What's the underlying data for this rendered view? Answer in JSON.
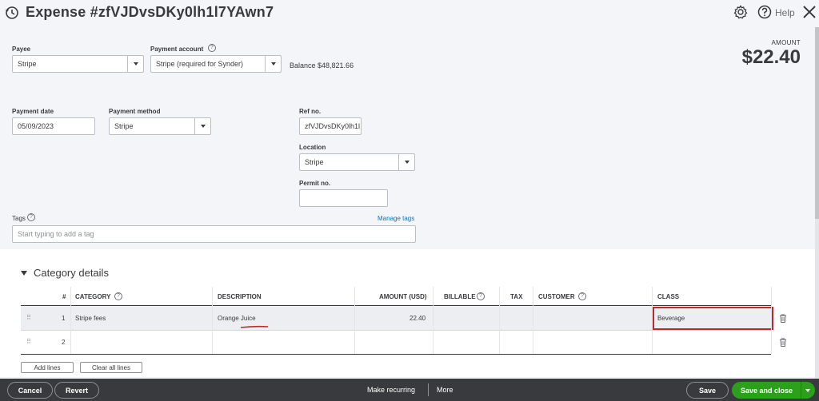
{
  "header": {
    "title": "Expense #zfVJDvsDKy0lh1l7YAwn7",
    "help_label": "Help"
  },
  "form": {
    "payee": {
      "label": "Payee",
      "value": "Stripe"
    },
    "payment_account": {
      "label": "Payment account",
      "value": "Stripe (required for Synder)"
    },
    "balance": "Balance $48,821.66",
    "amount_label": "AMOUNT",
    "amount_value": "$22.40",
    "payment_date": {
      "label": "Payment date",
      "value": "05/09/2023"
    },
    "payment_method": {
      "label": "Payment method",
      "value": "Stripe"
    },
    "ref_no": {
      "label": "Ref no.",
      "value": "zfVJDvsDKy0lh1l"
    },
    "location": {
      "label": "Location",
      "value": "Stripe"
    },
    "permit_no": {
      "label": "Permit no.",
      "value": ""
    },
    "tags": {
      "label": "Tags",
      "placeholder": "Start typing to add a tag",
      "manage": "Manage tags"
    }
  },
  "category_details": {
    "title": "Category details",
    "columns": [
      "#",
      "CATEGORY",
      "DESCRIPTION",
      "AMOUNT (USD)",
      "BILLABLE",
      "TAX",
      "CUSTOMER",
      "CLASS"
    ],
    "rows": [
      {
        "num": "1",
        "category": "Stripe fees",
        "description": "Orange Juice",
        "amount": "22.40",
        "billable": "",
        "tax": "",
        "customer": "",
        "class": "Beverage"
      },
      {
        "num": "2",
        "category": "",
        "description": "",
        "amount": "",
        "billable": "",
        "tax": "",
        "customer": "",
        "class": ""
      }
    ],
    "add_lines": "Add lines",
    "clear_lines": "Clear all lines"
  },
  "footer": {
    "cancel": "Cancel",
    "revert": "Revert",
    "make_recurring": "Make recurring",
    "more": "More",
    "save": "Save",
    "save_close": "Save and close"
  },
  "colors": {
    "accent_green": "#2ca01c",
    "link_blue": "#0077c5",
    "highlight_red": "#c0282b",
    "footer_bg": "#393a3d"
  }
}
